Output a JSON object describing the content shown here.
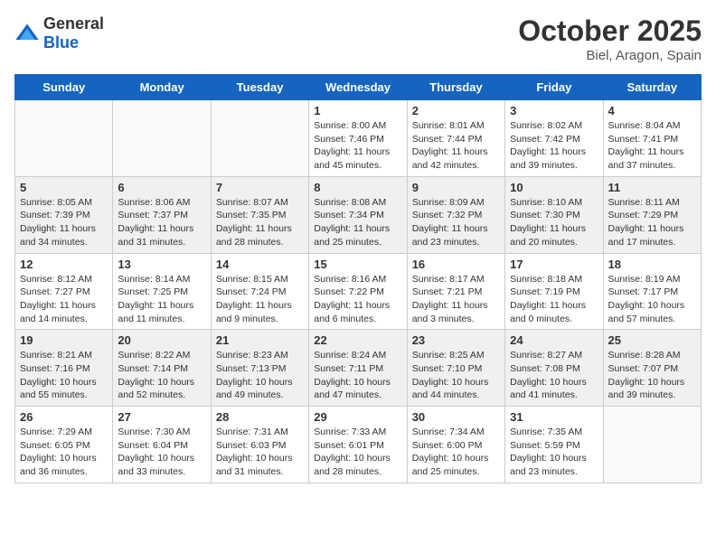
{
  "logo": {
    "general": "General",
    "blue": "Blue"
  },
  "title": {
    "month": "October 2025",
    "location": "Biel, Aragon, Spain"
  },
  "weekdays": [
    "Sunday",
    "Monday",
    "Tuesday",
    "Wednesday",
    "Thursday",
    "Friday",
    "Saturday"
  ],
  "weeks": [
    [
      {
        "day": "",
        "sunrise": "",
        "sunset": "",
        "daylight": ""
      },
      {
        "day": "",
        "sunrise": "",
        "sunset": "",
        "daylight": ""
      },
      {
        "day": "",
        "sunrise": "",
        "sunset": "",
        "daylight": ""
      },
      {
        "day": "1",
        "sunrise": "Sunrise: 8:00 AM",
        "sunset": "Sunset: 7:46 PM",
        "daylight": "Daylight: 11 hours and 45 minutes."
      },
      {
        "day": "2",
        "sunrise": "Sunrise: 8:01 AM",
        "sunset": "Sunset: 7:44 PM",
        "daylight": "Daylight: 11 hours and 42 minutes."
      },
      {
        "day": "3",
        "sunrise": "Sunrise: 8:02 AM",
        "sunset": "Sunset: 7:42 PM",
        "daylight": "Daylight: 11 hours and 39 minutes."
      },
      {
        "day": "4",
        "sunrise": "Sunrise: 8:04 AM",
        "sunset": "Sunset: 7:41 PM",
        "daylight": "Daylight: 11 hours and 37 minutes."
      }
    ],
    [
      {
        "day": "5",
        "sunrise": "Sunrise: 8:05 AM",
        "sunset": "Sunset: 7:39 PM",
        "daylight": "Daylight: 11 hours and 34 minutes."
      },
      {
        "day": "6",
        "sunrise": "Sunrise: 8:06 AM",
        "sunset": "Sunset: 7:37 PM",
        "daylight": "Daylight: 11 hours and 31 minutes."
      },
      {
        "day": "7",
        "sunrise": "Sunrise: 8:07 AM",
        "sunset": "Sunset: 7:35 PM",
        "daylight": "Daylight: 11 hours and 28 minutes."
      },
      {
        "day": "8",
        "sunrise": "Sunrise: 8:08 AM",
        "sunset": "Sunset: 7:34 PM",
        "daylight": "Daylight: 11 hours and 25 minutes."
      },
      {
        "day": "9",
        "sunrise": "Sunrise: 8:09 AM",
        "sunset": "Sunset: 7:32 PM",
        "daylight": "Daylight: 11 hours and 23 minutes."
      },
      {
        "day": "10",
        "sunrise": "Sunrise: 8:10 AM",
        "sunset": "Sunset: 7:30 PM",
        "daylight": "Daylight: 11 hours and 20 minutes."
      },
      {
        "day": "11",
        "sunrise": "Sunrise: 8:11 AM",
        "sunset": "Sunset: 7:29 PM",
        "daylight": "Daylight: 11 hours and 17 minutes."
      }
    ],
    [
      {
        "day": "12",
        "sunrise": "Sunrise: 8:12 AM",
        "sunset": "Sunset: 7:27 PM",
        "daylight": "Daylight: 11 hours and 14 minutes."
      },
      {
        "day": "13",
        "sunrise": "Sunrise: 8:14 AM",
        "sunset": "Sunset: 7:25 PM",
        "daylight": "Daylight: 11 hours and 11 minutes."
      },
      {
        "day": "14",
        "sunrise": "Sunrise: 8:15 AM",
        "sunset": "Sunset: 7:24 PM",
        "daylight": "Daylight: 11 hours and 9 minutes."
      },
      {
        "day": "15",
        "sunrise": "Sunrise: 8:16 AM",
        "sunset": "Sunset: 7:22 PM",
        "daylight": "Daylight: 11 hours and 6 minutes."
      },
      {
        "day": "16",
        "sunrise": "Sunrise: 8:17 AM",
        "sunset": "Sunset: 7:21 PM",
        "daylight": "Daylight: 11 hours and 3 minutes."
      },
      {
        "day": "17",
        "sunrise": "Sunrise: 8:18 AM",
        "sunset": "Sunset: 7:19 PM",
        "daylight": "Daylight: 11 hours and 0 minutes."
      },
      {
        "day": "18",
        "sunrise": "Sunrise: 8:19 AM",
        "sunset": "Sunset: 7:17 PM",
        "daylight": "Daylight: 10 hours and 57 minutes."
      }
    ],
    [
      {
        "day": "19",
        "sunrise": "Sunrise: 8:21 AM",
        "sunset": "Sunset: 7:16 PM",
        "daylight": "Daylight: 10 hours and 55 minutes."
      },
      {
        "day": "20",
        "sunrise": "Sunrise: 8:22 AM",
        "sunset": "Sunset: 7:14 PM",
        "daylight": "Daylight: 10 hours and 52 minutes."
      },
      {
        "day": "21",
        "sunrise": "Sunrise: 8:23 AM",
        "sunset": "Sunset: 7:13 PM",
        "daylight": "Daylight: 10 hours and 49 minutes."
      },
      {
        "day": "22",
        "sunrise": "Sunrise: 8:24 AM",
        "sunset": "Sunset: 7:11 PM",
        "daylight": "Daylight: 10 hours and 47 minutes."
      },
      {
        "day": "23",
        "sunrise": "Sunrise: 8:25 AM",
        "sunset": "Sunset: 7:10 PM",
        "daylight": "Daylight: 10 hours and 44 minutes."
      },
      {
        "day": "24",
        "sunrise": "Sunrise: 8:27 AM",
        "sunset": "Sunset: 7:08 PM",
        "daylight": "Daylight: 10 hours and 41 minutes."
      },
      {
        "day": "25",
        "sunrise": "Sunrise: 8:28 AM",
        "sunset": "Sunset: 7:07 PM",
        "daylight": "Daylight: 10 hours and 39 minutes."
      }
    ],
    [
      {
        "day": "26",
        "sunrise": "Sunrise: 7:29 AM",
        "sunset": "Sunset: 6:05 PM",
        "daylight": "Daylight: 10 hours and 36 minutes."
      },
      {
        "day": "27",
        "sunrise": "Sunrise: 7:30 AM",
        "sunset": "Sunset: 6:04 PM",
        "daylight": "Daylight: 10 hours and 33 minutes."
      },
      {
        "day": "28",
        "sunrise": "Sunrise: 7:31 AM",
        "sunset": "Sunset: 6:03 PM",
        "daylight": "Daylight: 10 hours and 31 minutes."
      },
      {
        "day": "29",
        "sunrise": "Sunrise: 7:33 AM",
        "sunset": "Sunset: 6:01 PM",
        "daylight": "Daylight: 10 hours and 28 minutes."
      },
      {
        "day": "30",
        "sunrise": "Sunrise: 7:34 AM",
        "sunset": "Sunset: 6:00 PM",
        "daylight": "Daylight: 10 hours and 25 minutes."
      },
      {
        "day": "31",
        "sunrise": "Sunrise: 7:35 AM",
        "sunset": "Sunset: 5:59 PM",
        "daylight": "Daylight: 10 hours and 23 minutes."
      },
      {
        "day": "",
        "sunrise": "",
        "sunset": "",
        "daylight": ""
      }
    ]
  ]
}
